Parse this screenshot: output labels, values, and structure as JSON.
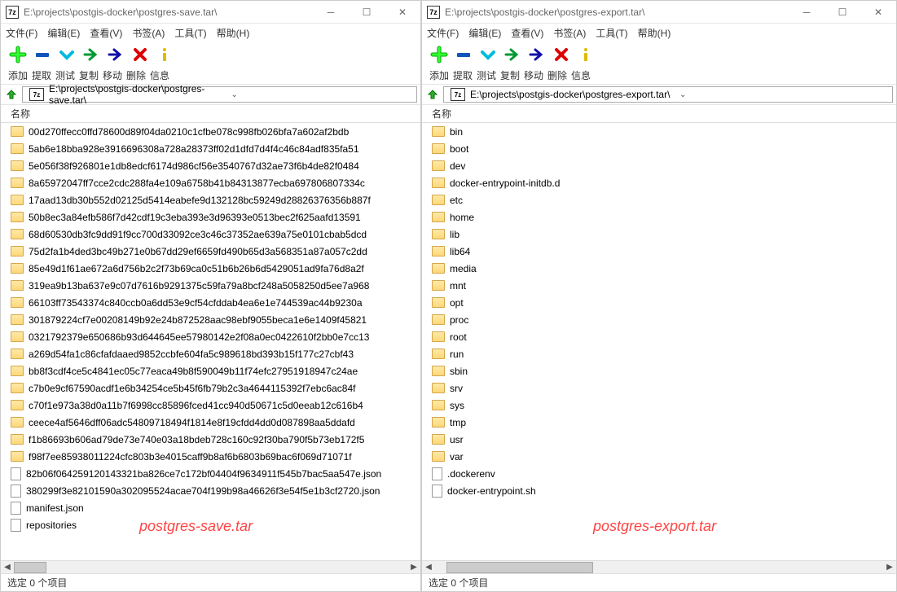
{
  "left": {
    "title": "E:\\projects\\postgis-docker\\postgres-save.tar\\",
    "address": "E:\\projects\\postgis-docker\\postgres-save.tar\\",
    "annotation": "postgres-save.tar",
    "menu": {
      "file": "文件(F)",
      "edit": "编辑(E)",
      "view": "查看(V)",
      "bookmark": "书签(A)",
      "tools": "工具(T)",
      "help": "帮助(H)"
    },
    "toolbar": {
      "add": "添加",
      "extract": "提取",
      "test": "测试",
      "copy": "复制",
      "move": "移动",
      "delete": "删除",
      "info": "信息"
    },
    "column_name": "名称",
    "status": "选定 0 个项目",
    "items": [
      {
        "t": "folder",
        "n": "00d270ffecc0ffd78600d89f04da0210c1cfbe078c998fb026bfa7a602af2bdb"
      },
      {
        "t": "folder",
        "n": "5ab6e18bba928e3916696308a728a28373ff02d1dfd7d4f4c46c84adf835fa51"
      },
      {
        "t": "folder",
        "n": "5e056f38f926801e1db8edcf6174d986cf56e3540767d32ae73f6b4de82f0484"
      },
      {
        "t": "folder",
        "n": "8a65972047ff7cce2cdc288fa4e109a6758b41b84313877ecba697806807334c"
      },
      {
        "t": "folder",
        "n": "17aad13db30b552d02125d5414eabefe9d132128bc59249d28826376356b887f"
      },
      {
        "t": "folder",
        "n": "50b8ec3a84efb586f7d42cdf19c3eba393e3d96393e0513bec2f625aafd13591"
      },
      {
        "t": "folder",
        "n": "68d60530db3fc9dd91f9cc700d33092ce3c46c37352ae639a75e0101cbab5dcd"
      },
      {
        "t": "folder",
        "n": "75d2fa1b4ded3bc49b271e0b67dd29ef6659fd490b65d3a568351a87a057c2dd"
      },
      {
        "t": "folder",
        "n": "85e49d1f61ae672a6d756b2c2f73b69ca0c51b6b26b6d5429051ad9fa76d8a2f"
      },
      {
        "t": "folder",
        "n": "319ea9b13ba637e9c07d7616b9291375c59fa79a8bcf248a5058250d5ee7a968"
      },
      {
        "t": "folder",
        "n": "66103ff73543374c840ccb0a6dd53e9cf54cfddab4ea6e1e744539ac44b9230a"
      },
      {
        "t": "folder",
        "n": "301879224cf7e00208149b92e24b872528aac98ebf9055beca1e6e1409f45821"
      },
      {
        "t": "folder",
        "n": "0321792379e650686b93d644645ee57980142e2f08a0ec0422610f2bb0e7cc13"
      },
      {
        "t": "folder",
        "n": "a269d54fa1c86cfafdaaed9852ccbfe604fa5c989618bd393b15f177c27cbf43"
      },
      {
        "t": "folder",
        "n": "bb8f3cdf4ce5c4841ec05c77eaca49b8f590049b11f74efc27951918947c24ae"
      },
      {
        "t": "folder",
        "n": "c7b0e9cf67590acdf1e6b34254ce5b45f6fb79b2c3a4644115392f7ebc6ac84f"
      },
      {
        "t": "folder",
        "n": "c70f1e973a38d0a11b7f6998cc85896fced41cc940d50671c5d0eeab12c616b4"
      },
      {
        "t": "folder",
        "n": "ceece4af5646dff06adc54809718494f1814e8f19cfdd4dd0d087898aa5ddafd"
      },
      {
        "t": "folder",
        "n": "f1b86693b606ad79de73e740e03a18bdeb728c160c92f30ba790f5b73eb172f5"
      },
      {
        "t": "folder",
        "n": "f98f7ee85938011224cfc803b3e4015caff9b8af6b6803b69bac6f069d71071f"
      },
      {
        "t": "json",
        "n": "82b06f064259120143321ba826ce7c172bf04404f9634911f545b7bac5aa547e.json"
      },
      {
        "t": "json",
        "n": "380299f3e82101590a302095524acae704f199b98a46626f3e54f5e1b3cf2720.json"
      },
      {
        "t": "json",
        "n": "manifest.json"
      },
      {
        "t": "plain",
        "n": "repositories"
      }
    ]
  },
  "right": {
    "title": "E:\\projects\\postgis-docker\\postgres-export.tar\\",
    "address": "E:\\projects\\postgis-docker\\postgres-export.tar\\",
    "annotation": "postgres-export.tar",
    "menu": {
      "file": "文件(F)",
      "edit": "编辑(E)",
      "view": "查看(V)",
      "bookmark": "书签(A)",
      "tools": "工具(T)",
      "help": "帮助(H)"
    },
    "toolbar": {
      "add": "添加",
      "extract": "提取",
      "test": "测试",
      "copy": "复制",
      "move": "移动",
      "delete": "删除",
      "info": "信息"
    },
    "column_name": "名称",
    "status": "选定 0 个项目",
    "items": [
      {
        "t": "folder",
        "n": "bin"
      },
      {
        "t": "folder",
        "n": "boot"
      },
      {
        "t": "folder",
        "n": "dev"
      },
      {
        "t": "folder",
        "n": "docker-entrypoint-initdb.d"
      },
      {
        "t": "folder",
        "n": "etc"
      },
      {
        "t": "folder",
        "n": "home"
      },
      {
        "t": "folder",
        "n": "lib"
      },
      {
        "t": "folder",
        "n": "lib64"
      },
      {
        "t": "folder",
        "n": "media"
      },
      {
        "t": "folder",
        "n": "mnt"
      },
      {
        "t": "folder",
        "n": "opt"
      },
      {
        "t": "folder",
        "n": "proc"
      },
      {
        "t": "folder",
        "n": "root"
      },
      {
        "t": "folder",
        "n": "run"
      },
      {
        "t": "folder",
        "n": "sbin"
      },
      {
        "t": "folder",
        "n": "srv"
      },
      {
        "t": "folder",
        "n": "sys"
      },
      {
        "t": "folder",
        "n": "tmp"
      },
      {
        "t": "folder",
        "n": "usr"
      },
      {
        "t": "folder",
        "n": "var"
      },
      {
        "t": "plain",
        "n": ".dockerenv"
      },
      {
        "t": "plain",
        "n": "docker-entrypoint.sh"
      }
    ]
  },
  "app_icon_text": "7z"
}
